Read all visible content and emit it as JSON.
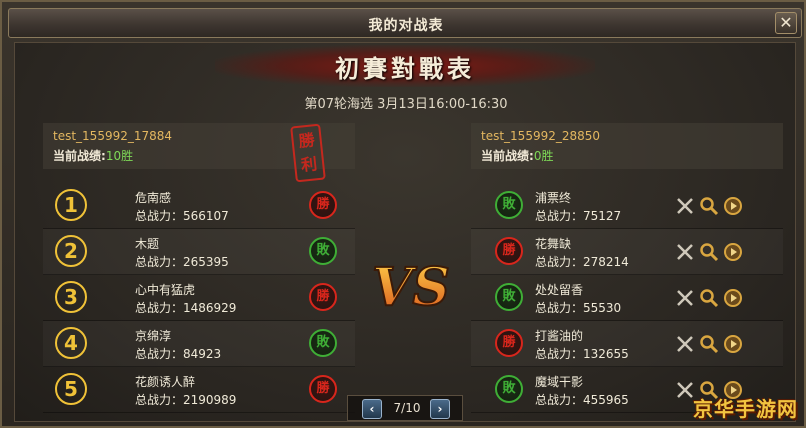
{
  "window": {
    "title": "我的对战表",
    "close_label": "✕"
  },
  "banner": {
    "title": "初賽對戰表",
    "round_info": "第07轮海选 3月13日16:00-16:30"
  },
  "result_seal": "勝利",
  "left_player": {
    "id": "test_155992_17884",
    "record_label": "当前战绩:",
    "record_value": "10胜"
  },
  "right_player": {
    "id": "test_155992_28850",
    "record_label": "当前战绩:",
    "record_value": "0胜"
  },
  "left_fighters": [
    {
      "num": "1",
      "name": "危南感",
      "power": "总战力：566107",
      "result": "勝"
    },
    {
      "num": "2",
      "name": "木题",
      "power": "总战力：265395",
      "result": "敗"
    },
    {
      "num": "3",
      "name": "心中有猛虎",
      "power": "总战力：1486929",
      "result": "勝"
    },
    {
      "num": "4",
      "name": "京绵淳",
      "power": "总战力：84923",
      "result": "敗"
    },
    {
      "num": "5",
      "name": "花颜诱人醉",
      "power": "总战力：2190989",
      "result": "勝"
    }
  ],
  "right_fighters": [
    {
      "name": "浦票终",
      "power": "总战力：75127",
      "result": "敗"
    },
    {
      "name": "花舞缺",
      "power": "总战力：278214",
      "result": "勝"
    },
    {
      "name": "处处留香",
      "power": "总战力：55530",
      "result": "敗"
    },
    {
      "name": "打酱油的",
      "power": "总战力：132655",
      "result": "勝"
    },
    {
      "name": "魔域干影",
      "power": "总战力：455965",
      "result": "敗"
    }
  ],
  "pager": {
    "text": "7/10",
    "prev_label": "‹",
    "next_label": "›"
  },
  "vs_text": "VS",
  "watermark": "京华手游网",
  "colors": {
    "win": "#d8261c",
    "lose": "#3fae36",
    "number": "#f0c238",
    "player_id": "#e3b760",
    "wins_count": "#7ed957"
  },
  "icons": {
    "close": "close-icon",
    "result_win": "win-badge",
    "result_lose": "lose-badge",
    "action_x": "cross-swords-icon",
    "action_search": "magnifier-icon",
    "action_play": "play-icon"
  }
}
